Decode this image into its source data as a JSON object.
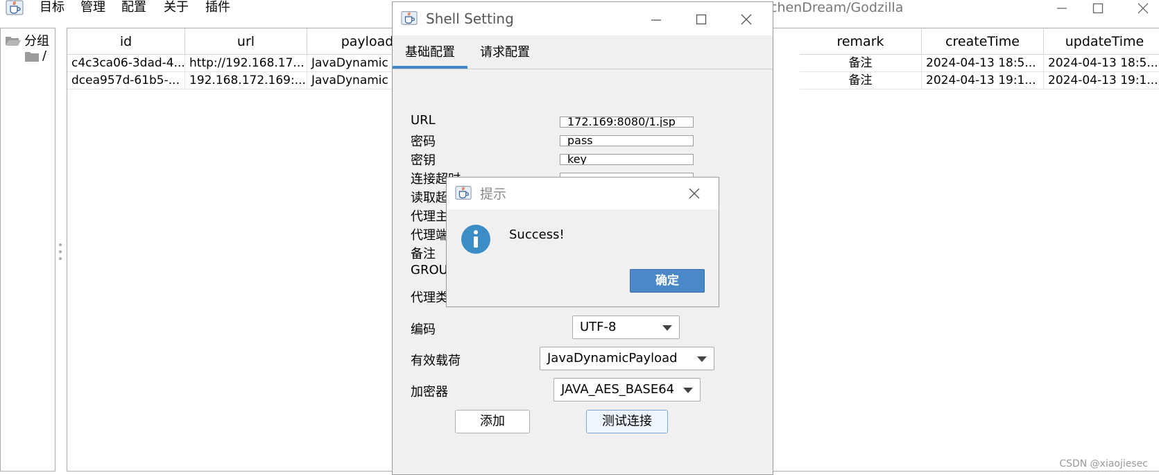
{
  "colors": {
    "accent": "#3f86cc",
    "ok_button": "#4a88c8",
    "info_icon": "#3c8dc5",
    "folder": "#9a9a9a"
  },
  "main": {
    "menu": [
      "目标",
      "管理",
      "配置",
      "关于",
      "插件"
    ],
    "title_partial": "chenDream/Godzilla",
    "icon": "java-cup-icon"
  },
  "tree": {
    "root": "分组",
    "child": "/"
  },
  "table": {
    "columns_left": [
      "id",
      "url",
      "payload"
    ],
    "columns_right": [
      "remark",
      "createTime",
      "updateTime"
    ],
    "rows": [
      {
        "id": "c4c3ca06-3dad-4...",
        "url": "http://192.168.17...",
        "payload": "JavaDynamic",
        "remark": "备注",
        "createTime": "2024-04-13 18:5...",
        "updateTime": "2024-04-13 18:5..."
      },
      {
        "id": "dcea957d-61b5-...",
        "url": "192.168.172.169:...",
        "payload": "JavaDynamic",
        "remark": "备注",
        "createTime": "2024-04-13 19:1...",
        "updateTime": "2024-04-13 19:1..."
      }
    ]
  },
  "shell_dialog": {
    "title": "Shell Setting",
    "tabs": [
      "基础配置",
      "请求配置"
    ],
    "labels": {
      "url": "URL",
      "password": "密码",
      "key": "密钥",
      "conn_timeout": "连接超时",
      "read_timeout": "读取超",
      "proxy_host": "代理主",
      "proxy_port": "代理端",
      "remark": "备注",
      "group": "GROU",
      "proxy_type": "代理类",
      "encoding": "编码",
      "payload": "有效载荷",
      "cryption": "加密器"
    },
    "values": {
      "url": "172.169:8080/1.jsp",
      "password": "pass",
      "key": "key",
      "encoding": "UTF-8",
      "payload": "JavaDynamicPayload",
      "cryption": "JAVA_AES_BASE64"
    },
    "buttons": {
      "add": "添加",
      "test": "测试连接"
    }
  },
  "message_dialog": {
    "title": "提示",
    "text": "Success!",
    "ok": "确定",
    "icon": "info-icon"
  },
  "watermark": "CSDN @xiaojiesec"
}
